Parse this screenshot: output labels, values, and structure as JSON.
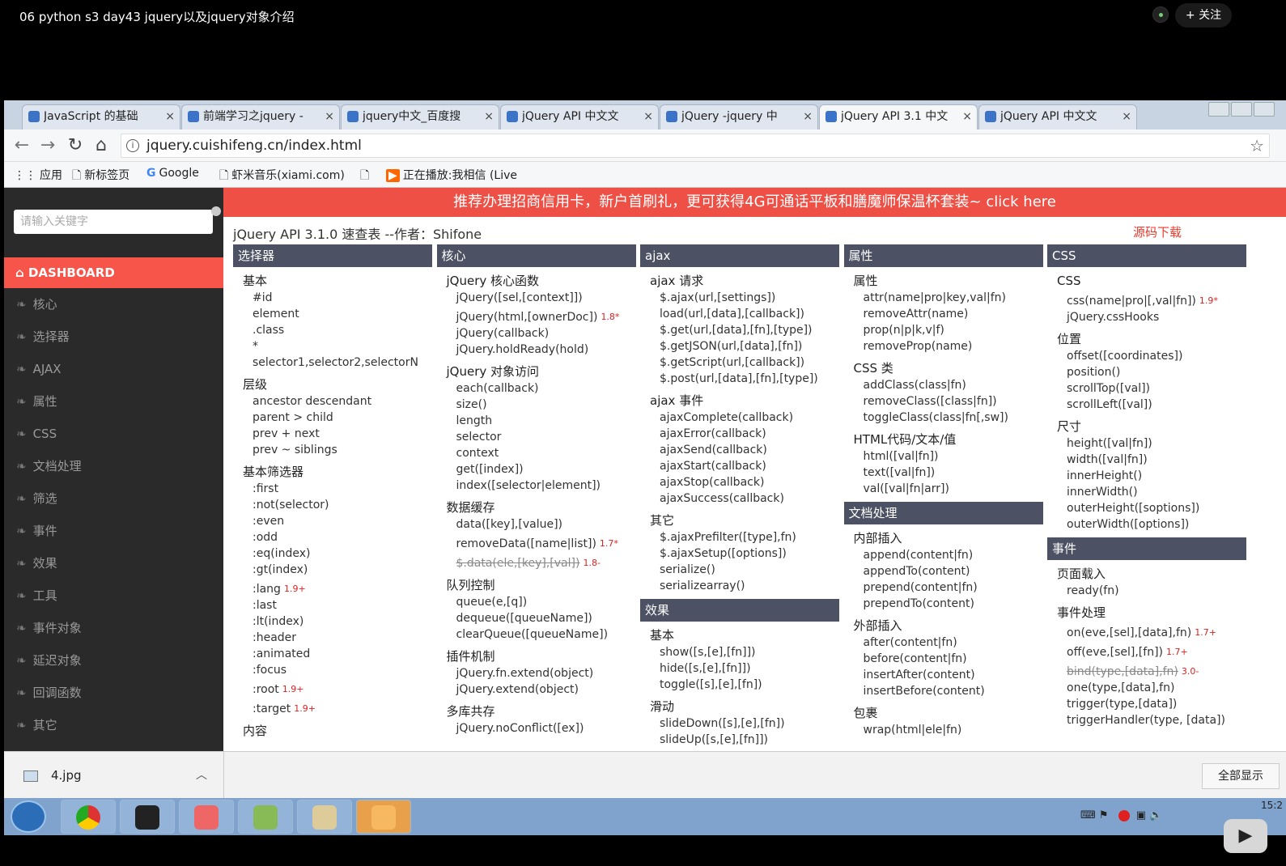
{
  "video": {
    "title": "06 python s3 day43 jquery以及jquery对象介绍",
    "follow": "+ 关注"
  },
  "browser": {
    "tabs": [
      {
        "label": "JavaScript 的基础"
      },
      {
        "label": "前端学习之jquery -"
      },
      {
        "label": "jquery中文_百度搜"
      },
      {
        "label": "jQuery API 中文文"
      },
      {
        "label": "jQuery -jquery 中"
      },
      {
        "label": "jQuery API 3.1 中文"
      },
      {
        "label": "jQuery API 中文文"
      }
    ],
    "tab_close": "×",
    "url": "jquery.cuishifeng.cn/index.html",
    "bookmarks": [
      "应用",
      "新标签页",
      "Google",
      "虾米音乐(xiami.com)",
      "",
      "正在播放:我相信 (Live"
    ]
  },
  "sidebar": {
    "search_placeholder": "请输入关键字",
    "dashboard": "DASHBOARD",
    "items": [
      "核心",
      "选择器",
      "AJAX",
      "属性",
      "CSS",
      "文档处理",
      "筛选",
      "事件",
      "效果",
      "工具",
      "事件对象",
      "延迟对象",
      "回调函数",
      "其它"
    ]
  },
  "page": {
    "banner": "推荐办理招商信用卡，新户首刷礼，更可获得4G可通话平板和膳魔师保温杯套装~ click here",
    "api_title": "jQuery API 3.1.0 速查表  --作者：Shifone",
    "source_download": "源码下载"
  },
  "columns": [
    {
      "sections": [
        {
          "head": "选择器",
          "groups": [
            {
              "title": "基本",
              "items": [
                {
                  "t": "#id"
                },
                {
                  "t": "element"
                },
                {
                  "t": ".class"
                },
                {
                  "t": "*"
                },
                {
                  "t": "selector1,selector2,selectorN"
                }
              ]
            },
            {
              "title": "层级",
              "items": [
                {
                  "t": "ancestor descendant"
                },
                {
                  "t": "parent > child"
                },
                {
                  "t": "prev + next"
                },
                {
                  "t": "prev ~ siblings"
                }
              ]
            },
            {
              "title": "基本筛选器",
              "items": [
                {
                  "t": ":first"
                },
                {
                  "t": ":not(selector)"
                },
                {
                  "t": ":even"
                },
                {
                  "t": ":odd"
                },
                {
                  "t": ":eq(index)"
                },
                {
                  "t": ":gt(index)"
                },
                {
                  "t": ":lang",
                  "v": "1.9+"
                },
                {
                  "t": ":last"
                },
                {
                  "t": ":lt(index)"
                },
                {
                  "t": ":header"
                },
                {
                  "t": ":animated"
                },
                {
                  "t": ":focus"
                },
                {
                  "t": ":root",
                  "v": "1.9+"
                },
                {
                  "t": ":target",
                  "v": "1.9+"
                }
              ]
            },
            {
              "title": "内容",
              "items": []
            }
          ]
        }
      ]
    },
    {
      "sections": [
        {
          "head": "核心",
          "groups": [
            {
              "title": "jQuery 核心函数",
              "items": [
                {
                  "t": "jQuery([sel,[context]])"
                },
                {
                  "t": "jQuery(html,[ownerDoc])",
                  "v": "1.8*"
                },
                {
                  "t": "jQuery(callback)"
                },
                {
                  "t": "jQuery.holdReady(hold)"
                }
              ]
            },
            {
              "title": "jQuery 对象访问",
              "items": [
                {
                  "t": "each(callback)"
                },
                {
                  "t": "size()"
                },
                {
                  "t": "length"
                },
                {
                  "t": "selector"
                },
                {
                  "t": "context"
                },
                {
                  "t": "get([index])"
                },
                {
                  "t": "index([selector|element])"
                }
              ]
            },
            {
              "title": "数据缓存",
              "items": [
                {
                  "t": "data([key],[value])"
                },
                {
                  "t": "removeData([name|list])",
                  "v": "1.7*"
                },
                {
                  "t": "$.data(ele,[key],[val])",
                  "v": "1.8-",
                  "s": true
                }
              ]
            },
            {
              "title": "队列控制",
              "items": [
                {
                  "t": "queue(e,[q])"
                },
                {
                  "t": "dequeue([queueName])"
                },
                {
                  "t": "clearQueue([queueName])"
                }
              ]
            },
            {
              "title": "插件机制",
              "items": [
                {
                  "t": "jQuery.fn.extend(object)"
                },
                {
                  "t": "jQuery.extend(object)"
                }
              ]
            },
            {
              "title": "多库共存",
              "items": [
                {
                  "t": "jQuery.noConflict([ex])"
                }
              ]
            }
          ]
        }
      ]
    },
    {
      "sections": [
        {
          "head": "ajax",
          "groups": [
            {
              "title": "ajax 请求",
              "items": [
                {
                  "t": "$.ajax(url,[settings])"
                },
                {
                  "t": "load(url,[data],[callback])"
                },
                {
                  "t": "$.get(url,[data],[fn],[type])"
                },
                {
                  "t": "$.getJSON(url,[data],[fn])"
                },
                {
                  "t": "$.getScript(url,[callback])"
                },
                {
                  "t": "$.post(url,[data],[fn],[type])"
                }
              ]
            },
            {
              "title": "ajax 事件",
              "items": [
                {
                  "t": "ajaxComplete(callback)"
                },
                {
                  "t": "ajaxError(callback)"
                },
                {
                  "t": "ajaxSend(callback)"
                },
                {
                  "t": "ajaxStart(callback)"
                },
                {
                  "t": "ajaxStop(callback)"
                },
                {
                  "t": "ajaxSuccess(callback)"
                }
              ]
            },
            {
              "title": "其它",
              "items": [
                {
                  "t": "$.ajaxPrefilter([type],fn)"
                },
                {
                  "t": "$.ajaxSetup([options])"
                },
                {
                  "t": "serialize()"
                },
                {
                  "t": "serializearray()"
                }
              ]
            }
          ]
        },
        {
          "head": "效果",
          "groups": [
            {
              "title": "基本",
              "items": [
                {
                  "t": "show([s,[e],[fn]])"
                },
                {
                  "t": "hide([s,[e],[fn]])"
                },
                {
                  "t": "toggle([s],[e],[fn])"
                }
              ]
            },
            {
              "title": "滑动",
              "items": [
                {
                  "t": "slideDown([s],[e],[fn])"
                },
                {
                  "t": "slideUp([s,[e],[fn]])"
                }
              ]
            }
          ]
        }
      ]
    },
    {
      "sections": [
        {
          "head": "属性",
          "groups": [
            {
              "title": "属性",
              "items": [
                {
                  "t": "attr(name|pro|key,val|fn)"
                },
                {
                  "t": "removeAttr(name)"
                },
                {
                  "t": "prop(n|p|k,v|f)"
                },
                {
                  "t": "removeProp(name)"
                }
              ]
            },
            {
              "title": "CSS 类",
              "items": [
                {
                  "t": "addClass(class|fn)"
                },
                {
                  "t": "removeClass([class|fn])"
                },
                {
                  "t": "toggleClass(class|fn[,sw])"
                }
              ]
            },
            {
              "title": "HTML代码/文本/值",
              "items": [
                {
                  "t": "html([val|fn])"
                },
                {
                  "t": "text([val|fn])"
                },
                {
                  "t": "val([val|fn|arr])"
                }
              ]
            }
          ]
        },
        {
          "head": "文档处理",
          "groups": [
            {
              "title": "内部插入",
              "items": [
                {
                  "t": "append(content|fn)"
                },
                {
                  "t": "appendTo(content)"
                },
                {
                  "t": "prepend(content|fn)"
                },
                {
                  "t": "prependTo(content)"
                }
              ]
            },
            {
              "title": "外部插入",
              "items": [
                {
                  "t": "after(content|fn)"
                },
                {
                  "t": "before(content|fn)"
                },
                {
                  "t": "insertAfter(content)"
                },
                {
                  "t": "insertBefore(content)"
                }
              ]
            },
            {
              "title": "包裹",
              "items": [
                {
                  "t": "wrap(html|ele|fn)"
                }
              ]
            }
          ]
        }
      ]
    },
    {
      "sections": [
        {
          "head": "CSS",
          "groups": [
            {
              "title": "CSS",
              "items": [
                {
                  "t": "css(name|pro|[,val|fn])",
                  "v": "1.9*"
                },
                {
                  "t": "jQuery.cssHooks"
                }
              ]
            },
            {
              "title": "位置",
              "items": [
                {
                  "t": "offset([coordinates])"
                },
                {
                  "t": "position()"
                },
                {
                  "t": "scrollTop([val])"
                },
                {
                  "t": "scrollLeft([val])"
                }
              ]
            },
            {
              "title": "尺寸",
              "items": [
                {
                  "t": "height([val|fn])"
                },
                {
                  "t": "width([val|fn])"
                },
                {
                  "t": "innerHeight()"
                },
                {
                  "t": "innerWidth()"
                },
                {
                  "t": "outerHeight([soptions])"
                },
                {
                  "t": "outerWidth([options])"
                }
              ]
            }
          ]
        },
        {
          "head": "事件",
          "groups": [
            {
              "title": "页面载入",
              "items": [
                {
                  "t": "ready(fn)"
                }
              ]
            },
            {
              "title": "事件处理",
              "items": [
                {
                  "t": "on(eve,[sel],[data],fn)",
                  "v": "1.7+"
                },
                {
                  "t": "off(eve,[sel],[fn])",
                  "v": "1.7+"
                },
                {
                  "t": "bind(type,[data],fn)",
                  "v": "3.0-",
                  "s": true
                },
                {
                  "t": "one(type,[data],fn)"
                },
                {
                  "t": "trigger(type,[data])"
                },
                {
                  "t": "triggerHandler(type, [data])"
                }
              ]
            }
          ]
        }
      ]
    }
  ],
  "download": {
    "file": "4.jpg",
    "show_all": "全部显示"
  },
  "taskbar": {
    "clock": "15:2"
  }
}
